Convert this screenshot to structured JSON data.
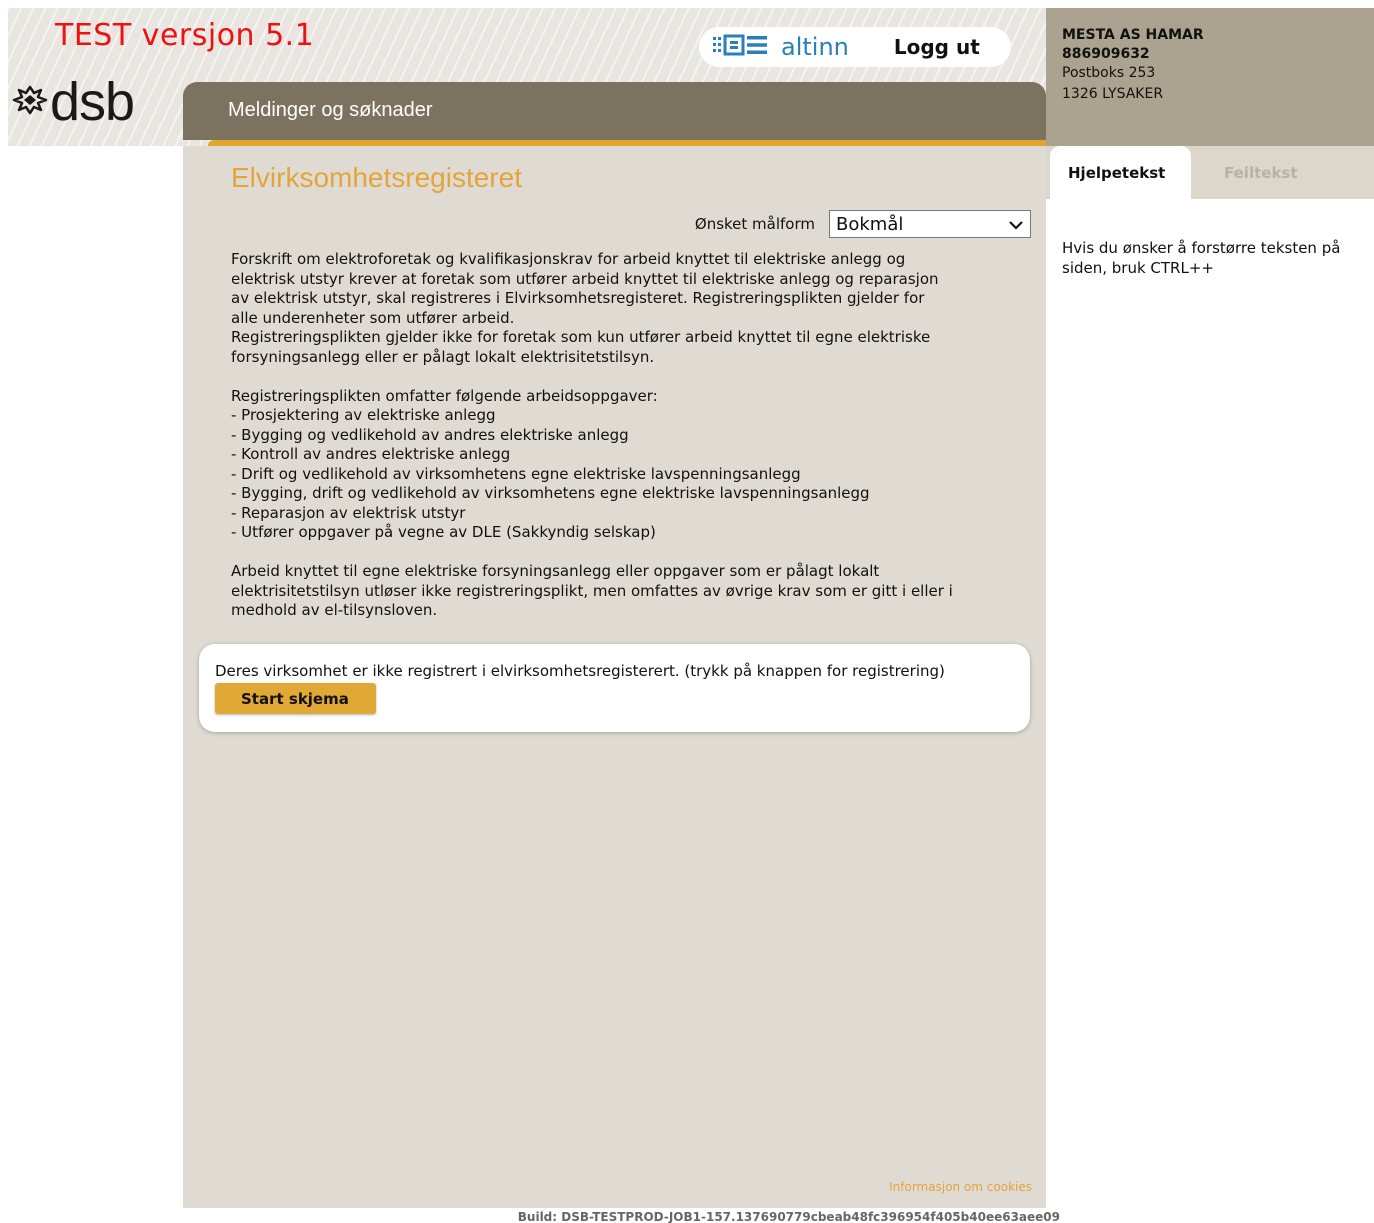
{
  "header": {
    "test_banner": "TEST versjon 5.1",
    "logo_text": "dsb",
    "altinn_label": "altinn",
    "logout_label": "Logg ut",
    "nav_title": "Meldinger og søknader",
    "colors": {
      "nav": "#7c7260",
      "accent": "#e1a62e",
      "test_red": "#ee1111",
      "altinn_blue": "#2a7fb8"
    }
  },
  "org": {
    "name": "MESTA AS HAMAR",
    "number": "886909632",
    "address_line1": "Postboks 253",
    "address_line2": "1326 LYSAKER"
  },
  "sidebar": {
    "tabs": [
      {
        "label": "Hjelpetekst",
        "active": true
      },
      {
        "label": "Feiltekst",
        "active": false
      }
    ],
    "help_text": "Hvis du ønsker å forstørre teksten på siden, bruk CTRL++"
  },
  "main": {
    "title": "Elvirksomhetsregisteret",
    "language_label": "Ønsket målform",
    "language_selected": "Bokmål",
    "paragraph1_lines": [
      "Forskrift om elektroforetak og kvalifikasjonskrav for arbeid knyttet til elektriske anlegg og",
      "elektrisk utstyr krever at foretak som utfører arbeid knyttet til elektriske anlegg og reparasjon",
      "av elektrisk utstyr, skal registreres i Elvirksomhetsregisteret. Registreringsplikten gjelder for",
      "alle underenheter som utfører arbeid.",
      "Registreringsplikten gjelder ikke for foretak som kun utfører arbeid knyttet til egne elektriske",
      "forsyningsanlegg eller er pålagt lokalt elektrisitetstilsyn."
    ],
    "list_intro": "Registreringsplikten omfatter følgende arbeidsoppgaver:",
    "list_items": [
      "- Prosjektering av elektriske anlegg",
      "- Bygging og vedlikehold av andres elektriske anlegg",
      "- Kontroll av andres elektriske anlegg",
      "- Drift og vedlikehold av virksomhetens egne elektriske lavspenningsanlegg",
      "- Bygging, drift og vedlikehold av virksomhetens egne elektriske lavspenningsanlegg",
      "- Reparasjon av elektrisk utstyr",
      "- Utfører oppgaver på vegne av DLE (Sakkyndig selskap)"
    ],
    "paragraph3_lines": [
      "Arbeid knyttet til egne elektriske forsyningsanlegg eller oppgaver som er pålagt lokalt",
      "elektrisitetstilsyn utløser ikke registreringsplikt, men omfattes av øvrige krav som er gitt i eller i",
      "medhold av el-tilsynsloven."
    ],
    "status_text": "Deres virksomhet er ikke registrert i elvirksomhetsregisterert. (trykk på knappen for registrering)",
    "start_button": "Start skjema",
    "cookies_link": "Informasjon om cookies"
  },
  "footer": {
    "build": "Build: DSB-TESTPROD-JOB1-157.137690779cbeab48fc396954f405b40ee63aee09"
  }
}
